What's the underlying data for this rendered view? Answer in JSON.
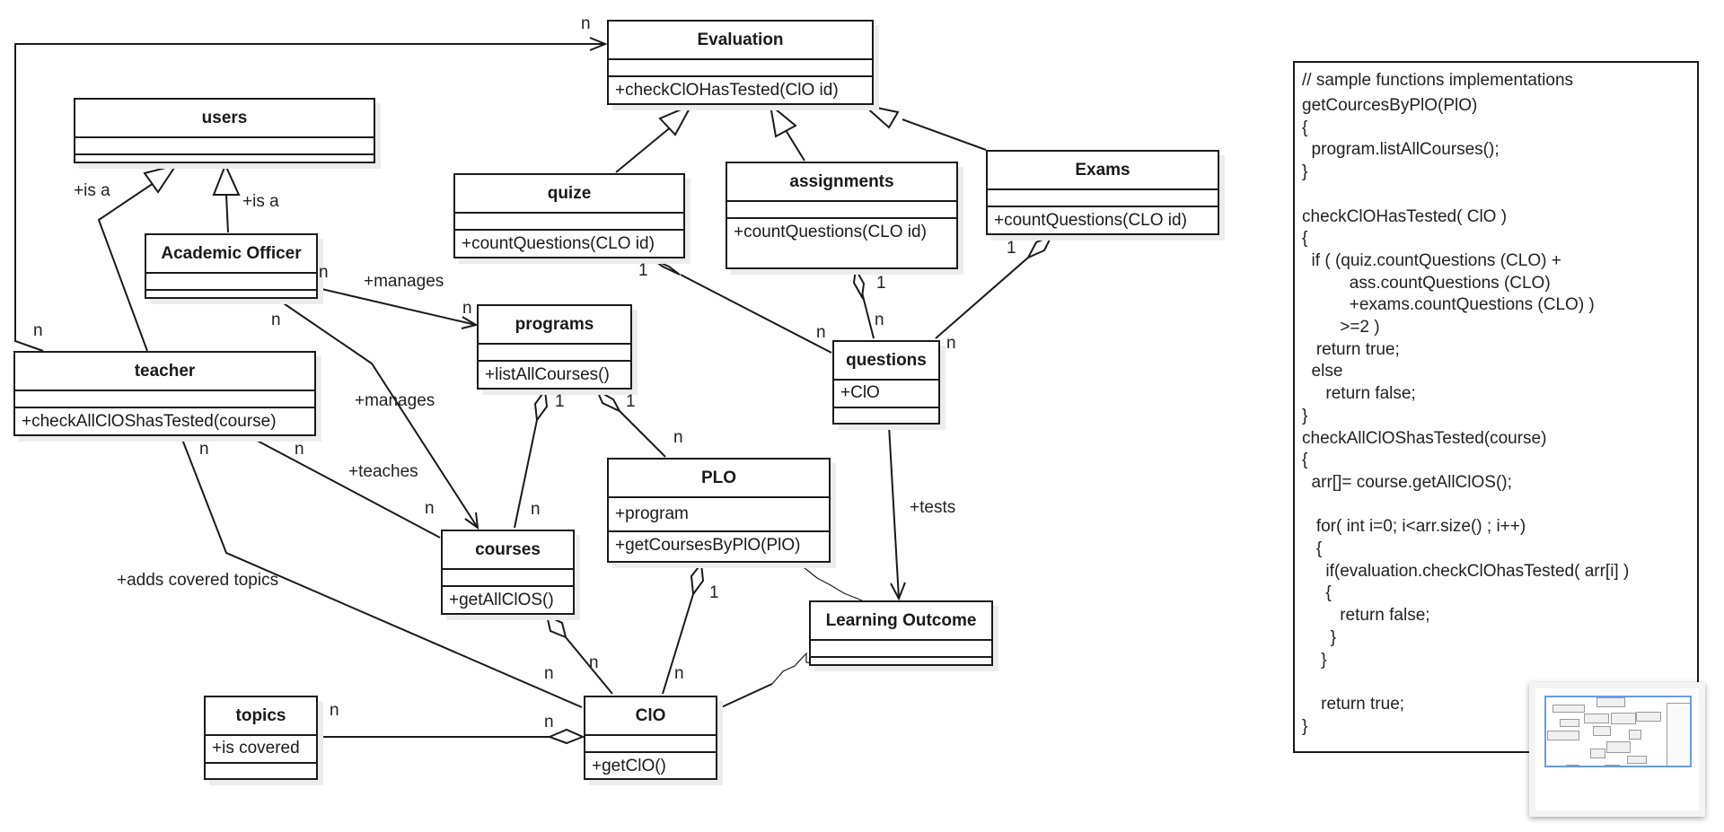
{
  "diagram": {
    "type": "UML class diagram",
    "classes": {
      "evaluation": {
        "name": "Evaluation",
        "attributes": [],
        "methods": [
          "+checkClOHasTested(ClO id)"
        ]
      },
      "users": {
        "name": "users",
        "attributes": [],
        "methods": []
      },
      "academic_officer": {
        "name": "Academic Officer",
        "attributes": [],
        "methods": []
      },
      "teacher": {
        "name": "teacher",
        "attributes": [],
        "methods": [
          "+checkAllClOShasTested(course)"
        ]
      },
      "quize": {
        "name": "quize",
        "attributes": [],
        "methods": [
          "+countQuestions(CLO id)"
        ]
      },
      "assignments": {
        "name": "assignments",
        "attributes": [],
        "methods": [
          "+countQuestions(CLO id)"
        ]
      },
      "exams": {
        "name": "Exams",
        "attributes": [],
        "methods": [
          "+countQuestions(CLO id)"
        ]
      },
      "programs": {
        "name": "programs",
        "attributes": [],
        "methods": [
          "+listAllCourses()"
        ]
      },
      "questions": {
        "name": "questions",
        "attributes": [
          "+ClO"
        ],
        "methods": []
      },
      "plo": {
        "name": "PLO",
        "attributes": [
          "+program"
        ],
        "methods": [
          "+getCoursesByPlO(PlO)"
        ]
      },
      "courses": {
        "name": "courses",
        "attributes": [],
        "methods": [
          "+getAllClOS()"
        ]
      },
      "learning_outcome": {
        "name": "Learning Outcome",
        "attributes": [],
        "methods": []
      },
      "topics": {
        "name": "topics",
        "attributes": [
          "+is covered"
        ],
        "methods": []
      },
      "clo": {
        "name": "ClO",
        "attributes": [],
        "methods": [
          "+getClO()"
        ]
      }
    },
    "relationships": [
      {
        "from": "teacher",
        "to": "evaluation",
        "kind": "association-directed",
        "target_multiplicity": "n",
        "source_multiplicity": "n"
      },
      {
        "from": "teacher",
        "to": "users",
        "kind": "generalization",
        "label": "+is a"
      },
      {
        "from": "academic_officer",
        "to": "users",
        "kind": "generalization",
        "label": "+is a"
      },
      {
        "from": "academic_officer",
        "to": "programs",
        "kind": "association-directed",
        "label": "+manages",
        "source_multiplicity": "n",
        "target_multiplicity": "n"
      },
      {
        "from": "academic_officer",
        "to": "courses",
        "kind": "association-directed",
        "label": "+manages",
        "source_multiplicity": "n",
        "target_multiplicity": ""
      },
      {
        "from": "teacher",
        "to": "courses",
        "kind": "association",
        "label": "+teaches",
        "source_multiplicity": "n",
        "target_multiplicity": "n"
      },
      {
        "from": "teacher",
        "to": "clo",
        "kind": "association",
        "label": "+adds covered topics",
        "source_multiplicity": "n",
        "target_multiplicity": "n"
      },
      {
        "from": "quize",
        "to": "evaluation",
        "kind": "generalization"
      },
      {
        "from": "assignments",
        "to": "evaluation",
        "kind": "generalization"
      },
      {
        "from": "exams",
        "to": "evaluation",
        "kind": "generalization"
      },
      {
        "from": "questions",
        "to": "quize",
        "kind": "aggregation",
        "whole_multiplicity": "1",
        "part_multiplicity": "n"
      },
      {
        "from": "questions",
        "to": "assignments",
        "kind": "aggregation",
        "whole_multiplicity": "1",
        "part_multiplicity": "n"
      },
      {
        "from": "questions",
        "to": "exams",
        "kind": "aggregation",
        "whole_multiplicity": "1",
        "part_multiplicity": "n"
      },
      {
        "from": "courses",
        "to": "programs",
        "kind": "aggregation",
        "whole_multiplicity": "1",
        "part_multiplicity": "n"
      },
      {
        "from": "plo",
        "to": "programs",
        "kind": "aggregation",
        "whole_multiplicity": "1",
        "part_multiplicity": "n"
      },
      {
        "from": "clo",
        "to": "courses",
        "kind": "aggregation",
        "part_multiplicity": "n"
      },
      {
        "from": "clo",
        "to": "plo",
        "kind": "aggregation",
        "whole_multiplicity": "1",
        "part_multiplicity": "n"
      },
      {
        "from": "topics",
        "to": "clo",
        "kind": "aggregation",
        "part_multiplicity": "n",
        "whole_multiplicity": "n"
      },
      {
        "from": "questions",
        "to": "learning_outcome",
        "kind": "association-directed",
        "label": "+tests"
      },
      {
        "from": "plo",
        "to": "learning_outcome",
        "kind": "generalization-sketch"
      },
      {
        "from": "clo",
        "to": "learning_outcome",
        "kind": "generalization-sketch"
      }
    ],
    "labels": {
      "is_a_1": "+is a",
      "is_a_2": "+is a",
      "manages_1": "+manages",
      "manages_2": "+manages",
      "teaches": "+teaches",
      "adds_covered_topics": "+adds covered topics",
      "tests": "+tests",
      "one": "1",
      "n": "n"
    }
  },
  "code_note": {
    "lines": [
      "// sample functions implementations",
      "getCourcesByPlO(PlO)",
      "{",
      "  program.listAllCourses();",
      "}",
      "",
      "checkClOHasTested( ClO )",
      "{",
      "  if ( (quiz.countQuestions (CLO) +",
      "          ass.countQuestions (CLO)",
      "          +exams.countQuestions (CLO) )",
      "        >=2 )",
      "   return true;",
      "  else",
      "     return false;",
      "}",
      "checkAllClOShasTested(course)",
      "{",
      "  arr[]= course.getAllClOS();",
      "",
      "   for( int i=0; i<arr.size() ; i++)",
      "   {",
      "     if(evaluation.checkClOhasTested( arr[i] )",
      "     {",
      "        return false;",
      "      }",
      "    }",
      "",
      "    return true;",
      "}"
    ]
  },
  "minimap": {
    "label": "outline-navigator"
  },
  "colors": {
    "line": "#1a1a1a",
    "shadow": "#ececec",
    "minimap_viewport": "#6a9be8"
  }
}
